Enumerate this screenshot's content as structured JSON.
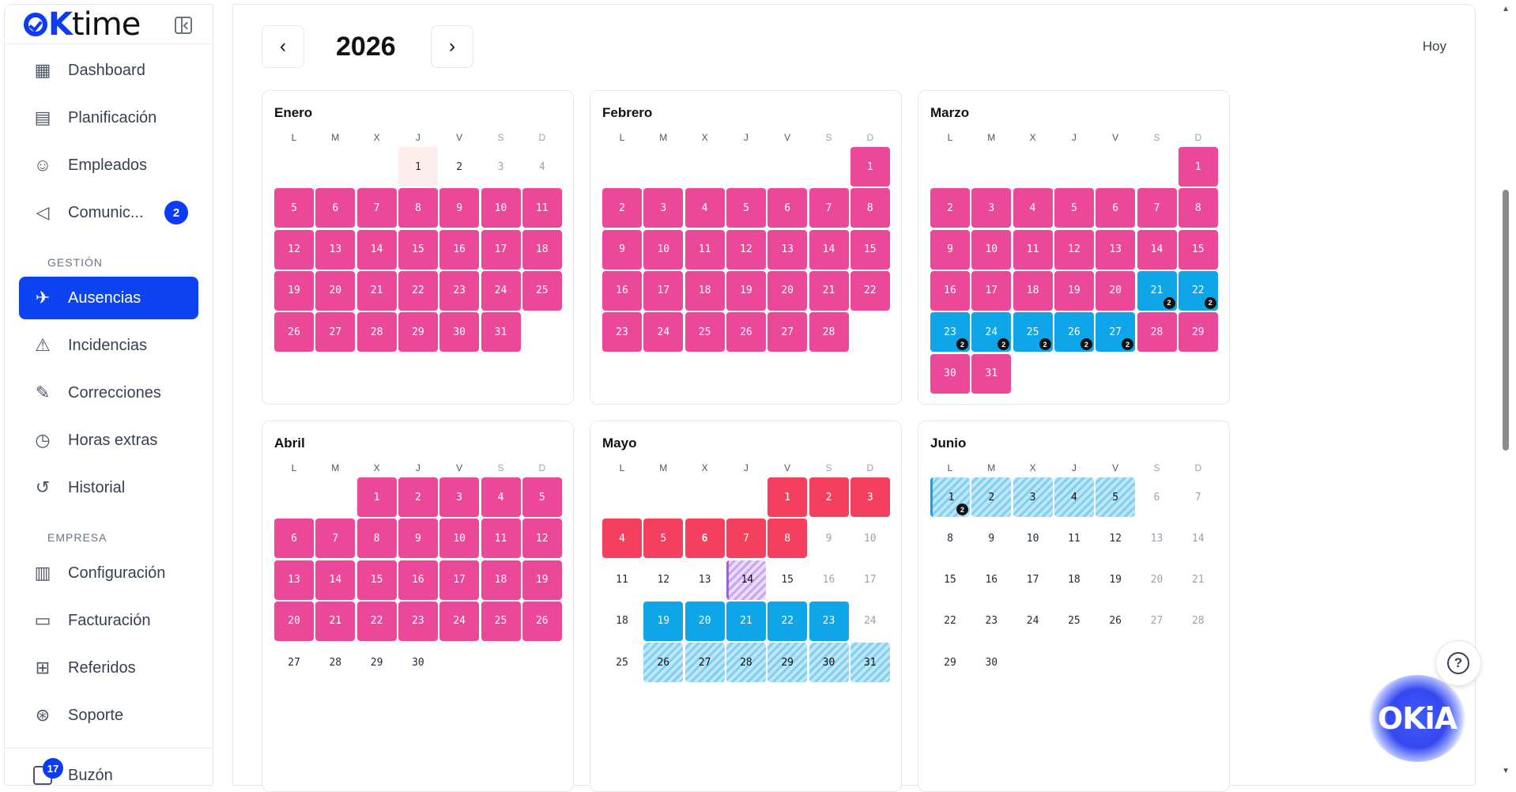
{
  "brand": {
    "ok": "OK",
    "time": "time"
  },
  "sidebar": {
    "items": [
      {
        "label": "Dashboard",
        "icon": "dashboard-icon"
      },
      {
        "label": "Planificación",
        "icon": "calendar-icon"
      },
      {
        "label": "Empleados",
        "icon": "users-icon"
      },
      {
        "label": "Comunic...",
        "icon": "megaphone-icon",
        "badge": "2"
      }
    ],
    "section_gestion": "GESTIÓN",
    "gestion_items": [
      {
        "label": "Ausencias",
        "icon": "plane-icon",
        "active": true
      },
      {
        "label": "Incidencias",
        "icon": "warning-icon"
      },
      {
        "label": "Correcciones",
        "icon": "file-edit-icon"
      },
      {
        "label": "Horas extras",
        "icon": "stopwatch-icon"
      },
      {
        "label": "Historial",
        "icon": "history-icon"
      }
    ],
    "section_empresa": "EMPRESA",
    "empresa_items": [
      {
        "label": "Configuración",
        "icon": "building-icon"
      },
      {
        "label": "Facturación",
        "icon": "credit-card-icon"
      },
      {
        "label": "Referidos",
        "icon": "gift-icon"
      },
      {
        "label": "Soporte",
        "icon": "lifebuoy-icon"
      }
    ],
    "buzon": {
      "label": "Buzón",
      "badge": "17"
    }
  },
  "header": {
    "year": "2026",
    "prev": "‹",
    "next": "›",
    "today": "Hoy"
  },
  "weekdays": [
    "L",
    "M",
    "X",
    "J",
    "V",
    "S",
    "D"
  ],
  "months": [
    {
      "name": "Enero",
      "offset": 3,
      "days": 31,
      "styles": {
        "1": "today",
        "2": "plain",
        "3": "wkd",
        "4": "wkd",
        "5": "pink",
        "6": "pink",
        "7": "pink",
        "8": "pink",
        "9": "pink",
        "10": "pink",
        "11": "pink",
        "12": "pink",
        "13": "pink",
        "14": "pink",
        "15": "pink",
        "16": "pink",
        "17": "pink",
        "18": "pink",
        "19": "pink",
        "20": "pink",
        "21": "pink",
        "22": "pink",
        "23": "pink",
        "24": "pink",
        "25": "pink",
        "26": "pink",
        "27": "pink",
        "28": "pink",
        "29": "pink",
        "30": "pink",
        "31": "pink"
      },
      "counts": {}
    },
    {
      "name": "Febrero",
      "offset": 6,
      "days": 28,
      "styles": {
        "1": "pink",
        "2": "pink",
        "3": "pink",
        "4": "pink",
        "5": "pink",
        "6": "pink",
        "7": "pink",
        "8": "pink",
        "9": "pink",
        "10": "pink",
        "11": "pink",
        "12": "pink",
        "13": "pink",
        "14": "pink",
        "15": "pink",
        "16": "pink",
        "17": "pink",
        "18": "pink",
        "19": "pink",
        "20": "pink",
        "21": "pink",
        "22": "pink",
        "23": "pink",
        "24": "pink",
        "25": "pink",
        "26": "pink",
        "27": "pink",
        "28": "pink"
      },
      "counts": {}
    },
    {
      "name": "Marzo",
      "offset": 6,
      "days": 31,
      "styles": {
        "1": "pink",
        "2": "pink",
        "3": "pink",
        "4": "pink",
        "5": "pink",
        "6": "pink",
        "7": "pink",
        "8": "pink",
        "9": "pink",
        "10": "pink",
        "11": "pink",
        "12": "pink",
        "13": "pink",
        "14": "pink",
        "15": "pink",
        "16": "pink",
        "17": "pink",
        "18": "pink",
        "19": "pink",
        "20": "pink",
        "21": "blue",
        "22": "blue",
        "23": "blue",
        "24": "blue",
        "25": "blue",
        "26": "blue",
        "27": "blue",
        "28": "pink",
        "29": "pink",
        "30": "pink",
        "31": "pink"
      },
      "counts": {
        "21": "2",
        "22": "2",
        "23": "2",
        "24": "2",
        "25": "2",
        "26": "2",
        "27": "2"
      }
    },
    {
      "name": "Abril",
      "offset": 2,
      "days": 30,
      "visible_rows": 5,
      "styles": {
        "1": "pink",
        "2": "pink",
        "3": "pink",
        "4": "pink",
        "5": "pink",
        "6": "pink",
        "7": "pink",
        "8": "pink",
        "9": "pink",
        "10": "pink",
        "11": "pink",
        "12": "pink",
        "13": "pink",
        "14": "pink",
        "15": "pink",
        "16": "pink",
        "17": "pink",
        "18": "pink",
        "19": "pink",
        "20": "pink",
        "21": "pink",
        "22": "pink",
        "23": "pink",
        "24": "pink",
        "25": "pink",
        "26": "pink",
        "27": "plain",
        "28": "plain",
        "29": "plain",
        "30": "plain"
      },
      "counts": {}
    },
    {
      "name": "Mayo",
      "offset": 4,
      "days": 31,
      "visible_rows": 5,
      "styles": {
        "1": "red",
        "2": "red",
        "3": "red",
        "4": "red",
        "5": "red",
        "6": "red-bold",
        "7": "red",
        "8": "red",
        "9": "wkd",
        "10": "wkd",
        "11": "plain",
        "12": "plain",
        "13": "plain",
        "14": "purple",
        "15": "plain",
        "16": "wkd",
        "17": "wkd",
        "18": "plain",
        "19": "blue",
        "20": "blue",
        "21": "blue",
        "22": "blue",
        "23": "blue",
        "24": "wkd",
        "25": "plain",
        "26": "striped",
        "27": "striped",
        "28": "striped",
        "29": "striped",
        "30": "striped",
        "31": "striped"
      },
      "counts": {}
    },
    {
      "name": "Junio",
      "offset": 0,
      "days": 30,
      "visible_rows": 5,
      "styles": {
        "1": "striped-first",
        "2": "striped",
        "3": "striped",
        "4": "striped",
        "5": "striped",
        "6": "wkd",
        "7": "wkd",
        "8": "plain",
        "9": "plain",
        "10": "plain",
        "11": "plain",
        "12": "plain",
        "13": "wkd",
        "14": "wkd",
        "15": "plain",
        "16": "plain",
        "17": "plain",
        "18": "plain",
        "19": "plain",
        "20": "wkd",
        "21": "wkd",
        "22": "plain",
        "23": "plain",
        "24": "plain",
        "25": "plain",
        "26": "plain",
        "27": "wkd",
        "28": "wkd",
        "29": "plain",
        "30": "plain"
      },
      "counts": {
        "1": "2"
      }
    }
  ],
  "help": {
    "symbol": "?"
  },
  "assistant": {
    "label": "OKiA"
  }
}
